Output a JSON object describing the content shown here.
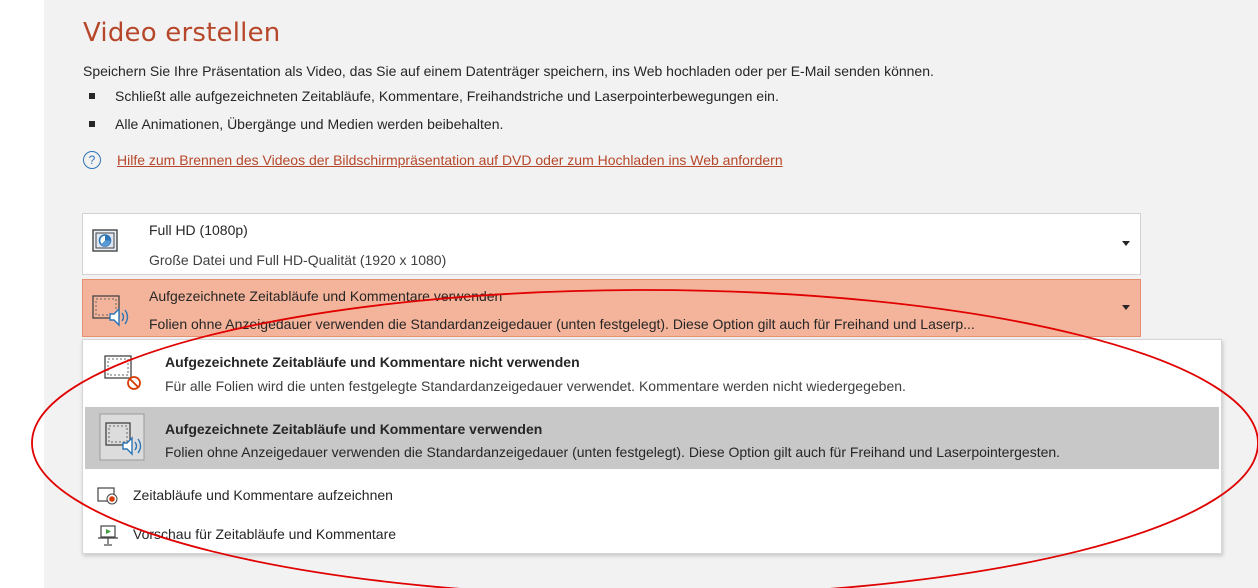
{
  "page": {
    "title": "Video erstellen",
    "description": "Speichern Sie Ihre Präsentation als Video, das Sie auf einem Datenträger speichern, ins Web hochladen oder per E-Mail senden können.",
    "bullets": [
      "Schließt alle aufgezeichneten Zeitabläufe, Kommentare, Freihandstriche und Laserpointerbewegungen ein.",
      "Alle Animationen, Übergänge und Medien werden beibehalten."
    ],
    "help_link": "Hilfe zum Brennen des Videos der Bildschirmpräsentation auf DVD oder zum Hochladen ins Web anfordern",
    "help_icon": "?"
  },
  "quality_dropdown": {
    "title": "Full HD (1080p)",
    "subtitle": "Große Datei und Full HD-Qualität (1920 x 1080)",
    "icon": "monitor-quality-icon"
  },
  "timing_dropdown": {
    "title": "Aufgezeichnete Zeitabläufe und Kommentare verwenden",
    "subtitle": "Folien ohne Anzeigedauer verwenden die Standardanzeigedauer (unten festgelegt). Diese Option gilt auch für Freihand und Laserp...",
    "icon": "slide-audio-icon",
    "highlight_color": "#f4b49b"
  },
  "menu": {
    "options": [
      {
        "title": "Aufgezeichnete Zeitabläufe und Kommentare nicht verwenden",
        "subtitle": "Für alle Folien wird die unten festgelegte Standardanzeigedauer verwendet. Kommentare werden nicht wiedergegeben.",
        "icon": "slide-no-audio-icon"
      },
      {
        "title": "Aufgezeichnete Zeitabläufe und Kommentare verwenden",
        "subtitle": "Folien ohne Anzeigedauer verwenden die Standardanzeigedauer (unten festgelegt). Diese Option gilt auch für Freihand und Laserpointergesten.",
        "icon": "slide-audio-icon",
        "selected": true
      }
    ],
    "actions": [
      {
        "label": "Zeitabläufe und Kommentare aufzeichnen",
        "icon": "record-icon"
      },
      {
        "label": "Vorschau für Zeitabläufe und Kommentare",
        "icon": "preview-icon"
      }
    ]
  },
  "colors": {
    "accent": "#b7472a",
    "link": "#b7472a",
    "selected_row": "#c8c8c8",
    "annotation_ellipse": "#e00000"
  }
}
